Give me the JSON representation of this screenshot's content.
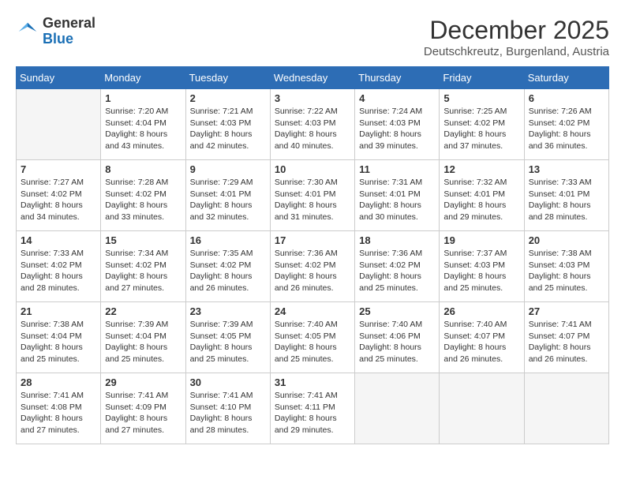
{
  "logo": {
    "general": "General",
    "blue": "Blue"
  },
  "header": {
    "month": "December 2025",
    "location": "Deutschkreutz, Burgenland, Austria"
  },
  "weekdays": [
    "Sunday",
    "Monday",
    "Tuesday",
    "Wednesday",
    "Thursday",
    "Friday",
    "Saturday"
  ],
  "weeks": [
    [
      {
        "day": null,
        "info": null
      },
      {
        "day": "1",
        "info": "Sunrise: 7:20 AM\nSunset: 4:04 PM\nDaylight: 8 hours\nand 43 minutes."
      },
      {
        "day": "2",
        "info": "Sunrise: 7:21 AM\nSunset: 4:03 PM\nDaylight: 8 hours\nand 42 minutes."
      },
      {
        "day": "3",
        "info": "Sunrise: 7:22 AM\nSunset: 4:03 PM\nDaylight: 8 hours\nand 40 minutes."
      },
      {
        "day": "4",
        "info": "Sunrise: 7:24 AM\nSunset: 4:03 PM\nDaylight: 8 hours\nand 39 minutes."
      },
      {
        "day": "5",
        "info": "Sunrise: 7:25 AM\nSunset: 4:02 PM\nDaylight: 8 hours\nand 37 minutes."
      },
      {
        "day": "6",
        "info": "Sunrise: 7:26 AM\nSunset: 4:02 PM\nDaylight: 8 hours\nand 36 minutes."
      }
    ],
    [
      {
        "day": "7",
        "info": "Sunrise: 7:27 AM\nSunset: 4:02 PM\nDaylight: 8 hours\nand 34 minutes."
      },
      {
        "day": "8",
        "info": "Sunrise: 7:28 AM\nSunset: 4:02 PM\nDaylight: 8 hours\nand 33 minutes."
      },
      {
        "day": "9",
        "info": "Sunrise: 7:29 AM\nSunset: 4:01 PM\nDaylight: 8 hours\nand 32 minutes."
      },
      {
        "day": "10",
        "info": "Sunrise: 7:30 AM\nSunset: 4:01 PM\nDaylight: 8 hours\nand 31 minutes."
      },
      {
        "day": "11",
        "info": "Sunrise: 7:31 AM\nSunset: 4:01 PM\nDaylight: 8 hours\nand 30 minutes."
      },
      {
        "day": "12",
        "info": "Sunrise: 7:32 AM\nSunset: 4:01 PM\nDaylight: 8 hours\nand 29 minutes."
      },
      {
        "day": "13",
        "info": "Sunrise: 7:33 AM\nSunset: 4:01 PM\nDaylight: 8 hours\nand 28 minutes."
      }
    ],
    [
      {
        "day": "14",
        "info": "Sunrise: 7:33 AM\nSunset: 4:02 PM\nDaylight: 8 hours\nand 28 minutes."
      },
      {
        "day": "15",
        "info": "Sunrise: 7:34 AM\nSunset: 4:02 PM\nDaylight: 8 hours\nand 27 minutes."
      },
      {
        "day": "16",
        "info": "Sunrise: 7:35 AM\nSunset: 4:02 PM\nDaylight: 8 hours\nand 26 minutes."
      },
      {
        "day": "17",
        "info": "Sunrise: 7:36 AM\nSunset: 4:02 PM\nDaylight: 8 hours\nand 26 minutes."
      },
      {
        "day": "18",
        "info": "Sunrise: 7:36 AM\nSunset: 4:02 PM\nDaylight: 8 hours\nand 25 minutes."
      },
      {
        "day": "19",
        "info": "Sunrise: 7:37 AM\nSunset: 4:03 PM\nDaylight: 8 hours\nand 25 minutes."
      },
      {
        "day": "20",
        "info": "Sunrise: 7:38 AM\nSunset: 4:03 PM\nDaylight: 8 hours\nand 25 minutes."
      }
    ],
    [
      {
        "day": "21",
        "info": "Sunrise: 7:38 AM\nSunset: 4:04 PM\nDaylight: 8 hours\nand 25 minutes."
      },
      {
        "day": "22",
        "info": "Sunrise: 7:39 AM\nSunset: 4:04 PM\nDaylight: 8 hours\nand 25 minutes."
      },
      {
        "day": "23",
        "info": "Sunrise: 7:39 AM\nSunset: 4:05 PM\nDaylight: 8 hours\nand 25 minutes."
      },
      {
        "day": "24",
        "info": "Sunrise: 7:40 AM\nSunset: 4:05 PM\nDaylight: 8 hours\nand 25 minutes."
      },
      {
        "day": "25",
        "info": "Sunrise: 7:40 AM\nSunset: 4:06 PM\nDaylight: 8 hours\nand 25 minutes."
      },
      {
        "day": "26",
        "info": "Sunrise: 7:40 AM\nSunset: 4:07 PM\nDaylight: 8 hours\nand 26 minutes."
      },
      {
        "day": "27",
        "info": "Sunrise: 7:41 AM\nSunset: 4:07 PM\nDaylight: 8 hours\nand 26 minutes."
      }
    ],
    [
      {
        "day": "28",
        "info": "Sunrise: 7:41 AM\nSunset: 4:08 PM\nDaylight: 8 hours\nand 27 minutes."
      },
      {
        "day": "29",
        "info": "Sunrise: 7:41 AM\nSunset: 4:09 PM\nDaylight: 8 hours\nand 27 minutes."
      },
      {
        "day": "30",
        "info": "Sunrise: 7:41 AM\nSunset: 4:10 PM\nDaylight: 8 hours\nand 28 minutes."
      },
      {
        "day": "31",
        "info": "Sunrise: 7:41 AM\nSunset: 4:11 PM\nDaylight: 8 hours\nand 29 minutes."
      },
      {
        "day": null,
        "info": null
      },
      {
        "day": null,
        "info": null
      },
      {
        "day": null,
        "info": null
      }
    ]
  ]
}
